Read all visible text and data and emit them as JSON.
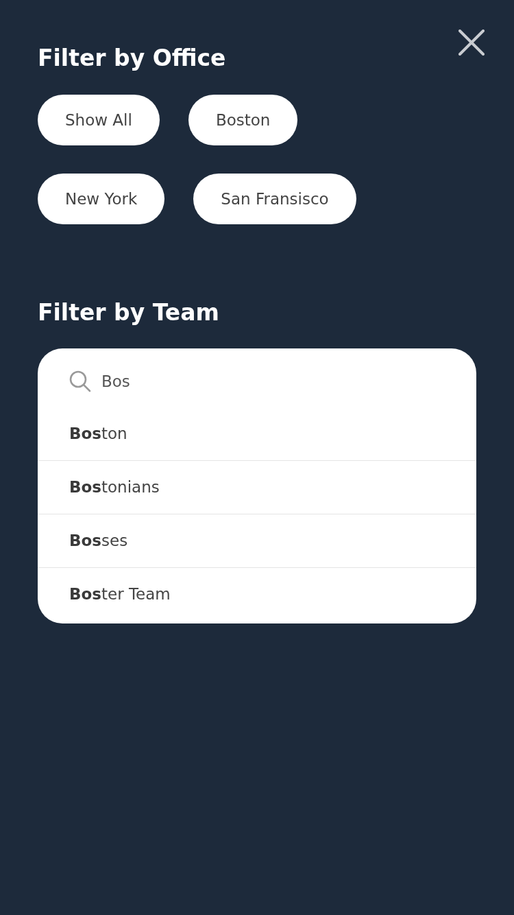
{
  "office_filter": {
    "title": "Filter by Office",
    "options": [
      {
        "label": "Show All"
      },
      {
        "label": "Boston"
      },
      {
        "label": "New York"
      },
      {
        "label": "San Fransisco"
      }
    ]
  },
  "team_filter": {
    "title": "Filter by Team",
    "search": {
      "value": "Bos"
    },
    "suggestions": [
      {
        "label": "**Bos**ton"
      },
      {
        "label": "**Bos**tonians"
      },
      {
        "label": "**Bos**ses"
      },
      {
        "label": "**Bos**ter Team"
      }
    ]
  }
}
